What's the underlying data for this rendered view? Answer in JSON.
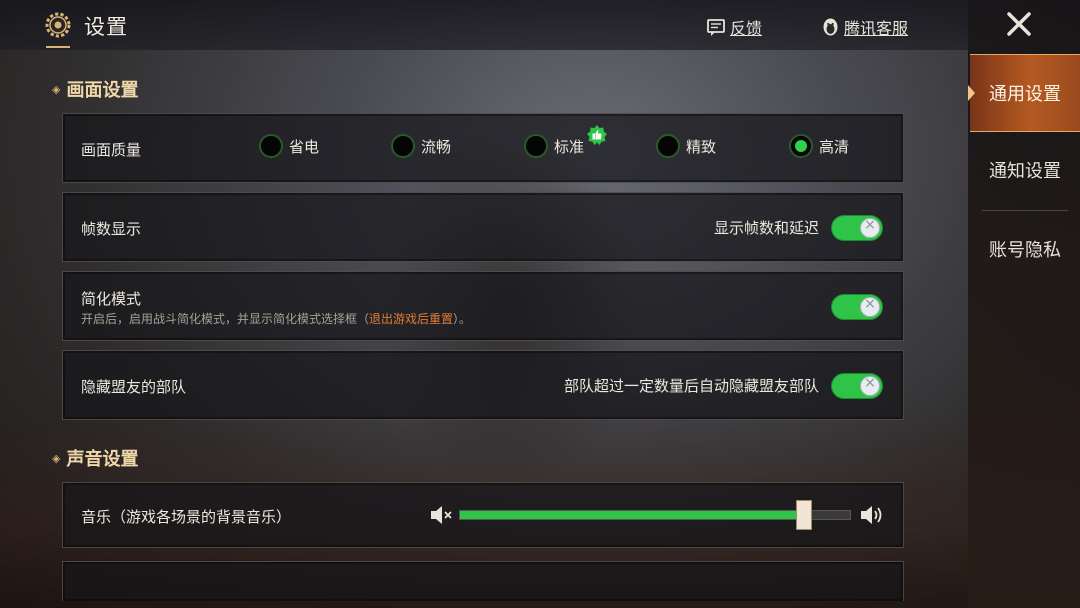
{
  "header": {
    "title": "设置",
    "feedback_label": "反馈",
    "support_label": "腾讯客服"
  },
  "sidebar": {
    "tabs": [
      {
        "label": "通用设置",
        "active": true
      },
      {
        "label": "通知设置",
        "active": false
      },
      {
        "label": "账号隐私",
        "active": false
      }
    ]
  },
  "display_section": {
    "title": "画面设置",
    "quality": {
      "label": "画面质量",
      "options": [
        {
          "label": "省电",
          "selected": false
        },
        {
          "label": "流畅",
          "selected": false
        },
        {
          "label": "标准",
          "selected": false,
          "recommended": true
        },
        {
          "label": "精致",
          "selected": false
        },
        {
          "label": "高清",
          "selected": true
        }
      ]
    },
    "fps": {
      "label": "帧数显示",
      "description": "显示帧数和延迟",
      "enabled": true
    },
    "simple_mode": {
      "label": "简化模式",
      "desc_prefix": "开启后，启用战斗简化模式，并显示简化模式选择框（",
      "desc_highlight": "退出游戏后重置",
      "desc_suffix": "）。",
      "enabled": true
    },
    "hide_allies": {
      "label": "隐藏盟友的部队",
      "description": "部队超过一定数量后自动隐藏盟友部队",
      "enabled": true
    }
  },
  "sound_section": {
    "title": "声音设置",
    "music": {
      "label": "音乐（游戏各场景的背景音乐）",
      "level": 0.88
    }
  },
  "colors": {
    "accent_green": "#2fc447",
    "highlight_orange": "#e57b33",
    "active_tab": "#b55a22"
  }
}
